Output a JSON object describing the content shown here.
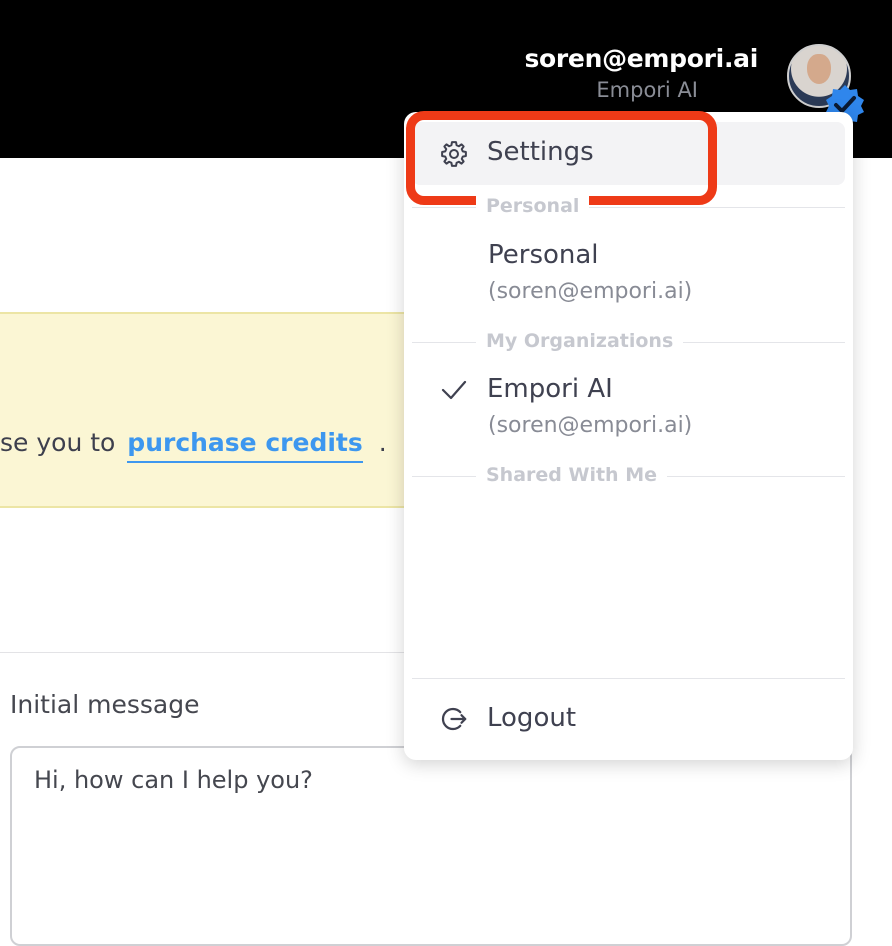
{
  "header": {
    "user_email": "soren@empori.ai",
    "user_org": "Empori AI",
    "verified_color": "#2f86ec"
  },
  "page": {
    "notice_text_before": "se you to",
    "notice_link": "purchase credits",
    "notice_text_after": ".",
    "initial_message_label": "Initial message",
    "initial_message_value": "Hi, how can I help you?"
  },
  "menu": {
    "settings": {
      "label": "Settings",
      "icon": "gear-icon"
    },
    "sections": {
      "personal": "Personal",
      "organizations": "My Organizations",
      "shared": "Shared With Me"
    },
    "personal_account": {
      "name": "Personal",
      "email": "(soren@empori.ai)"
    },
    "org_account": {
      "name": "Empori AI",
      "email": "(soren@empori.ai)",
      "selected": true
    },
    "logout": {
      "label": "Logout",
      "icon": "logout-icon"
    }
  },
  "colors": {
    "highlight": "#ee3a17",
    "link": "#3d97ef",
    "notice_bg": "#fbf6d4"
  }
}
